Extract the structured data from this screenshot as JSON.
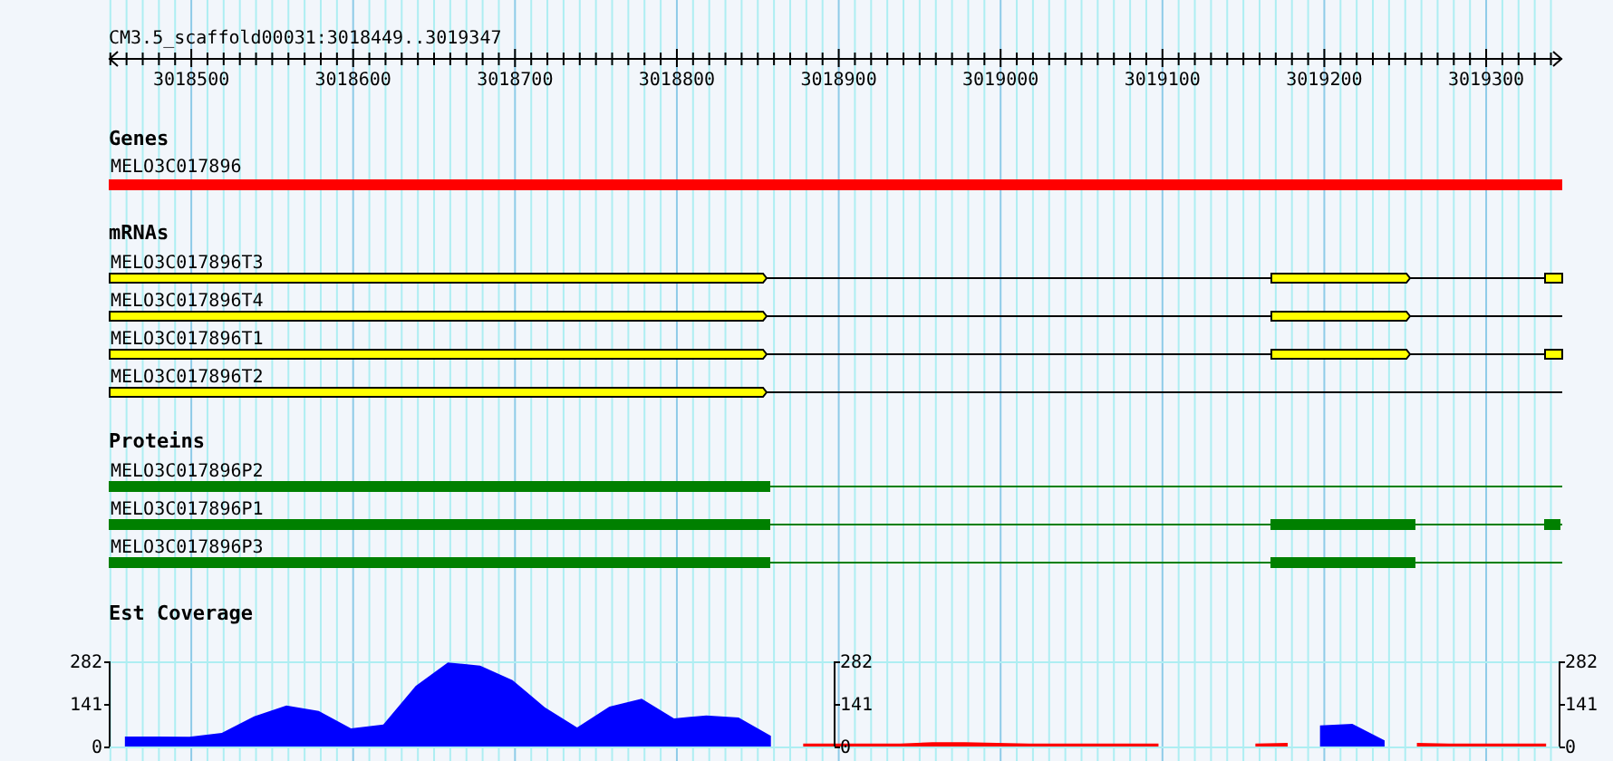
{
  "ruler": {
    "label": "CM3.5_scaffold00031:3018449..3019347",
    "ticks": [
      "3018500",
      "3018600",
      "3018700",
      "3018800",
      "3018900",
      "3019000",
      "3019100",
      "3019200",
      "3019300"
    ]
  },
  "tracks": [
    {
      "kind": "gene",
      "title": "Genes",
      "features": [
        {
          "name": "MELO3C017896"
        }
      ]
    },
    {
      "kind": "mrna",
      "title": "mRNAs",
      "features": [
        {
          "name": "MELO3C017896T3"
        },
        {
          "name": "MELO3C017896T4"
        },
        {
          "name": "MELO3C017896T1"
        },
        {
          "name": "MELO3C017896T2"
        }
      ]
    },
    {
      "kind": "protein",
      "title": "Proteins",
      "features": [
        {
          "name": "MELO3C017896P2"
        },
        {
          "name": "MELO3C017896P1"
        },
        {
          "name": "MELO3C017896P3"
        }
      ]
    },
    {
      "kind": "coverage",
      "title": "Est Coverage",
      "axes": [
        {
          "labels": [
            "282",
            "141",
            "0"
          ]
        },
        {
          "labels": [
            "282",
            "141",
            "0"
          ]
        },
        {
          "labels": [
            "282",
            "141",
            "0"
          ]
        }
      ],
      "chart_data": {
        "type": "area",
        "categories": [
          null,
          null,
          null,
          null,
          null,
          null,
          null,
          null,
          null,
          null,
          null,
          null,
          null,
          null,
          null,
          null,
          null,
          null,
          null,
          null,
          null,
          null,
          null,
          null,
          null,
          null,
          null,
          null,
          null,
          null,
          null,
          null,
          null,
          null,
          null,
          null,
          null,
          null,
          null,
          null,
          null,
          null,
          null,
          null,
          null
        ],
        "ylim": [
          0,
          282
        ],
        "yticks": [
          282,
          141,
          0
        ],
        "series": [
          {
            "color": "#0000ff",
            "values": [
              33,
              33,
              32,
              45,
              100,
              136,
              118,
              60,
              73,
              200,
              278,
              268,
              220,
              130,
              63,
              132,
              158,
              93,
              103,
              96,
              35,
              null,
              null,
              null,
              null,
              null,
              null,
              null,
              null,
              null,
              null,
              null,
              null,
              null,
              null,
              null,
              null,
              70,
              75,
              20,
              null,
              null,
              null,
              null,
              null
            ]
          },
          {
            "color": "#ff0000",
            "values": [
              null,
              null,
              null,
              null,
              null,
              null,
              null,
              null,
              null,
              null,
              null,
              null,
              null,
              null,
              null,
              null,
              null,
              null,
              null,
              null,
              null,
              10,
              10,
              10,
              10,
              14,
              14,
              12,
              10,
              10,
              10,
              10,
              10,
              null,
              null,
              10,
              12,
              null,
              null,
              null,
              12,
              10,
              10,
              10,
              10
            ]
          }
        ]
      }
    }
  ]
}
